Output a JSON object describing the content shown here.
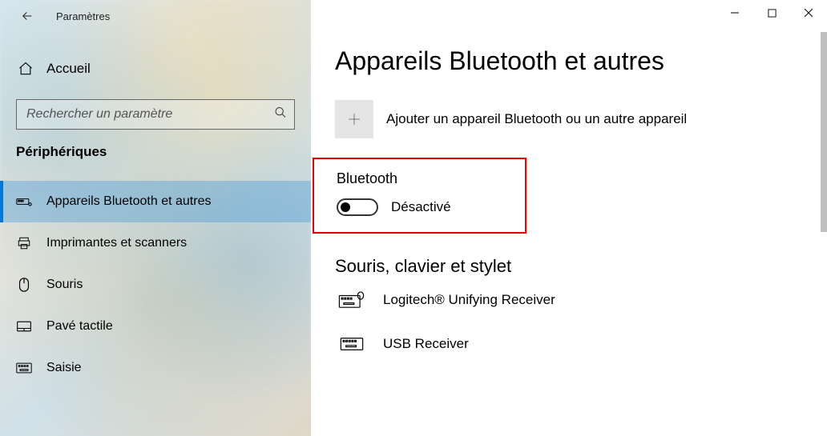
{
  "header": {
    "app_title": "Paramètres"
  },
  "sidebar": {
    "home_label": "Accueil",
    "search_placeholder": "Rechercher un paramètre",
    "section_title": "Périphériques",
    "items": [
      {
        "label": "Appareils Bluetooth et autres"
      },
      {
        "label": "Imprimantes et scanners"
      },
      {
        "label": "Souris"
      },
      {
        "label": "Pavé tactile"
      },
      {
        "label": "Saisie"
      }
    ]
  },
  "main": {
    "page_title": "Appareils Bluetooth et autres",
    "add_device_label": "Ajouter un appareil Bluetooth ou un autre appareil",
    "bluetooth_heading": "Bluetooth",
    "bluetooth_state_label": "Désactivé",
    "mouse_section_heading": "Souris, clavier et stylet",
    "devices": [
      {
        "label": "Logitech® Unifying Receiver"
      },
      {
        "label": "USB Receiver"
      }
    ]
  }
}
